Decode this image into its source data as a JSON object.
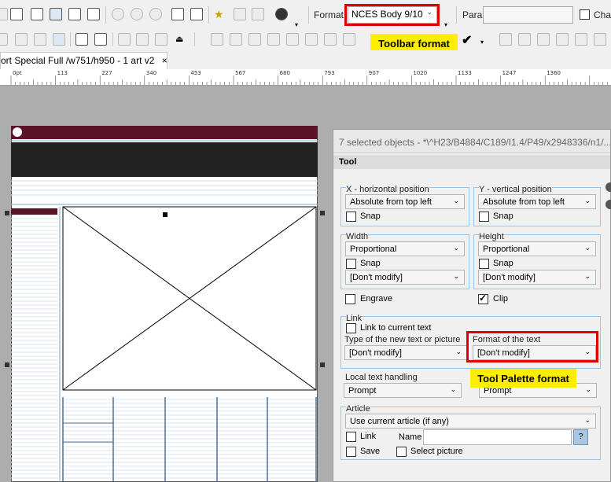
{
  "toolbar": {
    "format_label": "Format",
    "format_value": "NCES Body 9/10",
    "para_label": "Para",
    "para_value": "",
    "char_label": "Chai"
  },
  "annotations": {
    "toolbar_format": "Toolbar format",
    "tool_palette_format": "Tool Palette format"
  },
  "tab": {
    "title": "ort Special Full /w751/h950 - 1 art v2",
    "close": "×"
  },
  "ruler": {
    "ticks": [
      "0pt",
      "113",
      "227",
      "340",
      "453",
      "567",
      "680",
      "793",
      "907",
      "1020",
      "1133",
      "1247",
      "1360"
    ]
  },
  "panel": {
    "title": "7 selected objects - *\\^H23/B4884/C189/I1.4/P49/x2948336/n1/...",
    "section": "Tool",
    "x_pos": {
      "legend": "X - horizontal position",
      "value": "Absolute from top left",
      "snap": "Snap"
    },
    "y_pos": {
      "legend": "Y - vertical position",
      "value": "Absolute from top left",
      "snap": "Snap"
    },
    "width": {
      "legend": "Width",
      "value": "Proportional",
      "snap": "Snap",
      "modify": "[Don't modify]"
    },
    "height": {
      "legend": "Height",
      "value": "Proportional",
      "snap": "Snap",
      "modify": "[Don't modify]"
    },
    "engrave": "Engrave",
    "clip": "Clip",
    "link": {
      "legend": "Link",
      "link_current": "Link to current text",
      "type_label": "Type of the new text or picture",
      "type_value": "[Don't modify]",
      "format_label": "Format of the text",
      "format_value": "[Don't modify]"
    },
    "local_text": {
      "label": "Local text handling",
      "value": "Prompt",
      "value2": "Prompt"
    },
    "article": {
      "legend": "Article",
      "value": "Use current article (if any)",
      "link": "Link",
      "name_label": "Name",
      "name_value": "",
      "help": "?",
      "save": "Save",
      "select_picture": "Select picture"
    }
  },
  "colors": {
    "accent_red": "#e00000",
    "callout_yellow": "#ffee00",
    "header_maroon": "#5a1428"
  }
}
